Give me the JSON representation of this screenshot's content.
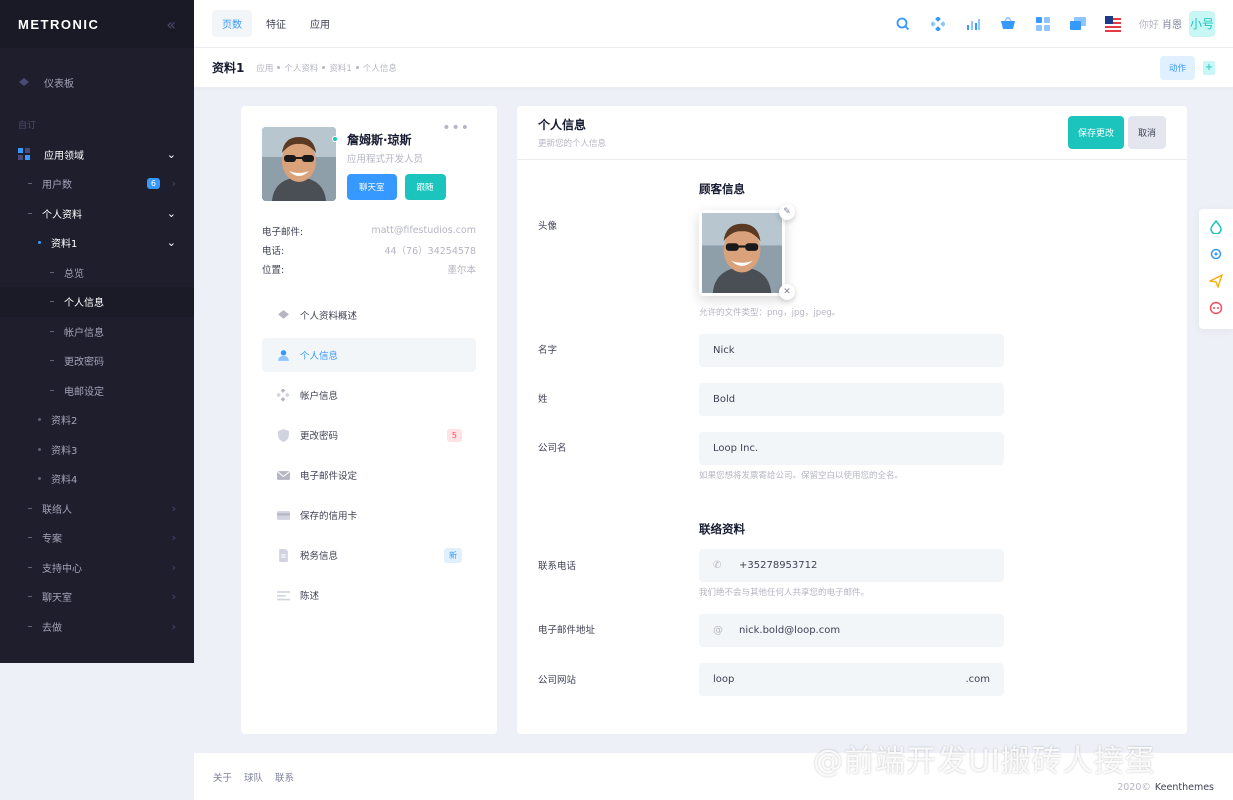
{
  "brand": "METRONIC",
  "sidebar": {
    "dashboard": "仪表板",
    "section": "自订",
    "app": "应用领域",
    "users": "用户数",
    "users_badge": "6",
    "profile": "个人资料",
    "profile1": "资料1",
    "overview": "总览",
    "personal": "个人信息",
    "account": "帐户信息",
    "password": "更改密码",
    "email": "电邮设定",
    "profile2": "资料2",
    "profile3": "资料3",
    "profile4": "资料4",
    "contacts": "联络人",
    "projects": "专案",
    "support": "支持中心",
    "chat": "聊天室",
    "todo": "去做"
  },
  "header": {
    "nav": [
      "页数",
      "特征",
      "应用"
    ],
    "greeting": "你好",
    "user": "肖恩",
    "avatar": "小号"
  },
  "subheader": {
    "title": "资料1",
    "crumbs": [
      "应用",
      "个人资料",
      "资料1",
      "个人信息"
    ],
    "action": "动作",
    "plus": "+"
  },
  "profile": {
    "name": "詹姆斯·琼斯",
    "role": "应用程式开发人员",
    "chat_btn": "聊天室",
    "follow_btn": "跟随",
    "email_label": "电子邮件:",
    "email_value": "matt@fifestudios.com",
    "phone_label": "电话:",
    "phone_value": "44（76）34254578",
    "location_label": "位置:",
    "location_value": "墨尔本",
    "menu": {
      "overview": "个人资料概述",
      "personal": "个人信息",
      "account": "帐户信息",
      "password": "更改密码",
      "password_badge": "5",
      "email": "电子邮件设定",
      "card": "保存的信用卡",
      "tax": "税务信息",
      "tax_badge": "新",
      "statements": "陈述"
    }
  },
  "form": {
    "title": "个人信息",
    "subtitle": "更新您的个人信息",
    "save": "保存更改",
    "cancel": "取消",
    "customer_section": "顾客信息",
    "avatar_label": "头像",
    "avatar_hint": "允许的文件类型：png，jpg，jpeg。",
    "first_name_label": "名字",
    "first_name": "Nick",
    "last_name_label": "姓",
    "last_name": "Bold",
    "company_label": "公司名",
    "company": "Loop Inc.",
    "company_hint": "如果您想将发票寄给公司。保留空白以使用您的全名。",
    "contact_section": "联络资料",
    "phone_label": "联系电话",
    "phone": "+35278953712",
    "phone_hint": "我们绝不会与其他任何人共享您的电子邮件。",
    "email_label": "电子邮件地址",
    "email_prefix": "@",
    "email": "nick.bold@loop.com",
    "site_label": "公司网站",
    "site": "loop",
    "site_suffix": ".com"
  },
  "footer": {
    "links": [
      "关于",
      "球队",
      "联系"
    ],
    "year": "2020©",
    "company": "Keenthemes"
  },
  "watermark": "@前端开发UI搬砖人接蛋",
  "colors": {
    "primary": "#3699ff",
    "success": "#1bc5bd",
    "danger": "#f64e60",
    "sidebar": "#1e1e2d"
  }
}
